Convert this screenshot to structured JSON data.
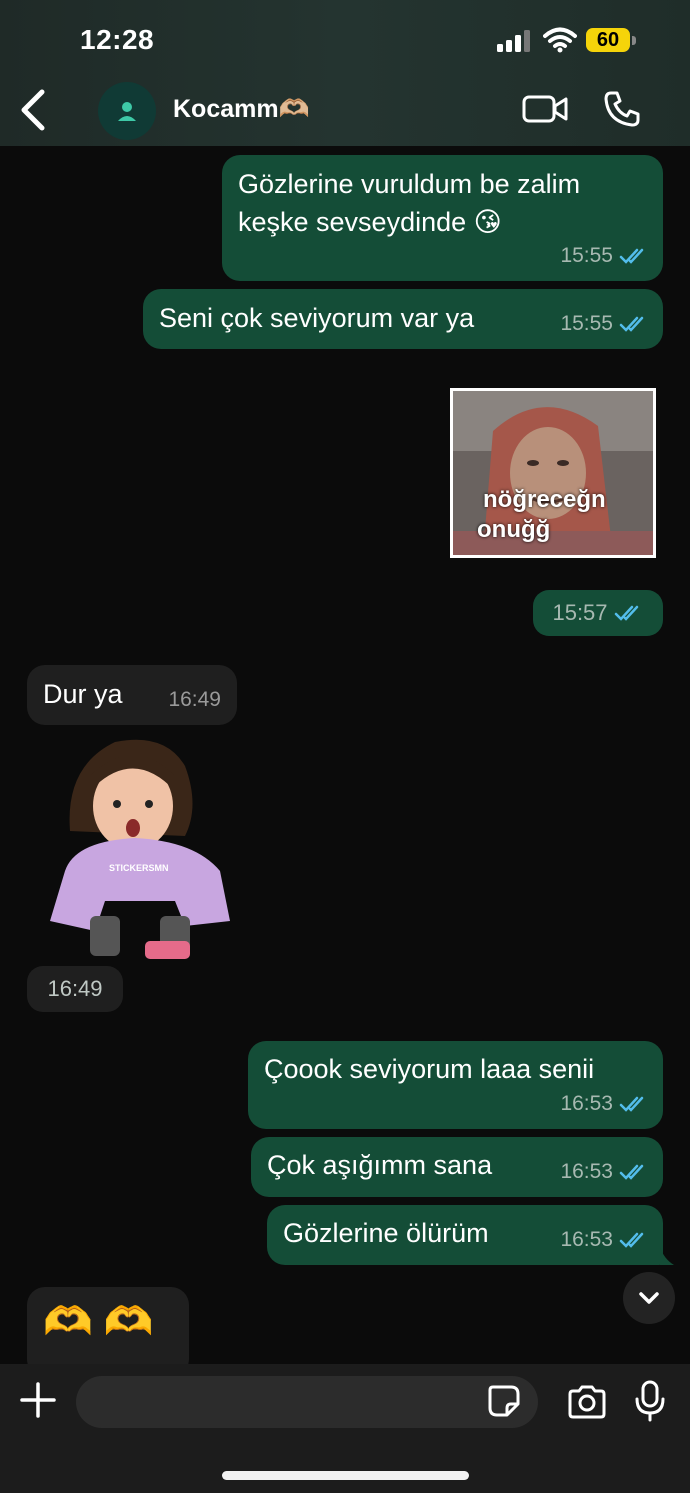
{
  "status_bar": {
    "time": "12:28",
    "battery": "60"
  },
  "header": {
    "contact_name": "Kocamm🫶🏼"
  },
  "messages": [
    {
      "direction": "out",
      "line1": "Gözlerine vuruldum be zalim",
      "line2": "keşke sevseydinde 😘",
      "time": "15:55"
    },
    {
      "direction": "out",
      "text": "Seni çok seviyorum var ya",
      "time": "15:55"
    },
    {
      "direction": "out",
      "type": "image",
      "caption_line1": "nöğreceğn",
      "caption_line2": "onuğğ",
      "time": "15:57"
    },
    {
      "direction": "in",
      "text": "Dur ya",
      "time": "16:49"
    },
    {
      "direction": "in",
      "type": "sticker",
      "sticker_text": "STICKERSMN",
      "time": "16:49"
    },
    {
      "direction": "out",
      "text": "Çoook seviyorum laaa senii",
      "time": "16:53"
    },
    {
      "direction": "out",
      "text": "Çok aşığımm sana",
      "time": "16:53"
    },
    {
      "direction": "out",
      "text": "Gözlerine ölürüm",
      "time": "16:53"
    },
    {
      "direction": "in",
      "text": "🫶 🫶"
    }
  ],
  "input": {
    "placeholder": ""
  },
  "colors": {
    "outgoing_bubble": "#144d37",
    "incoming_bubble": "#1f1f1f",
    "read_ticks": "#53bdeb",
    "battery": "#f5d40a"
  }
}
